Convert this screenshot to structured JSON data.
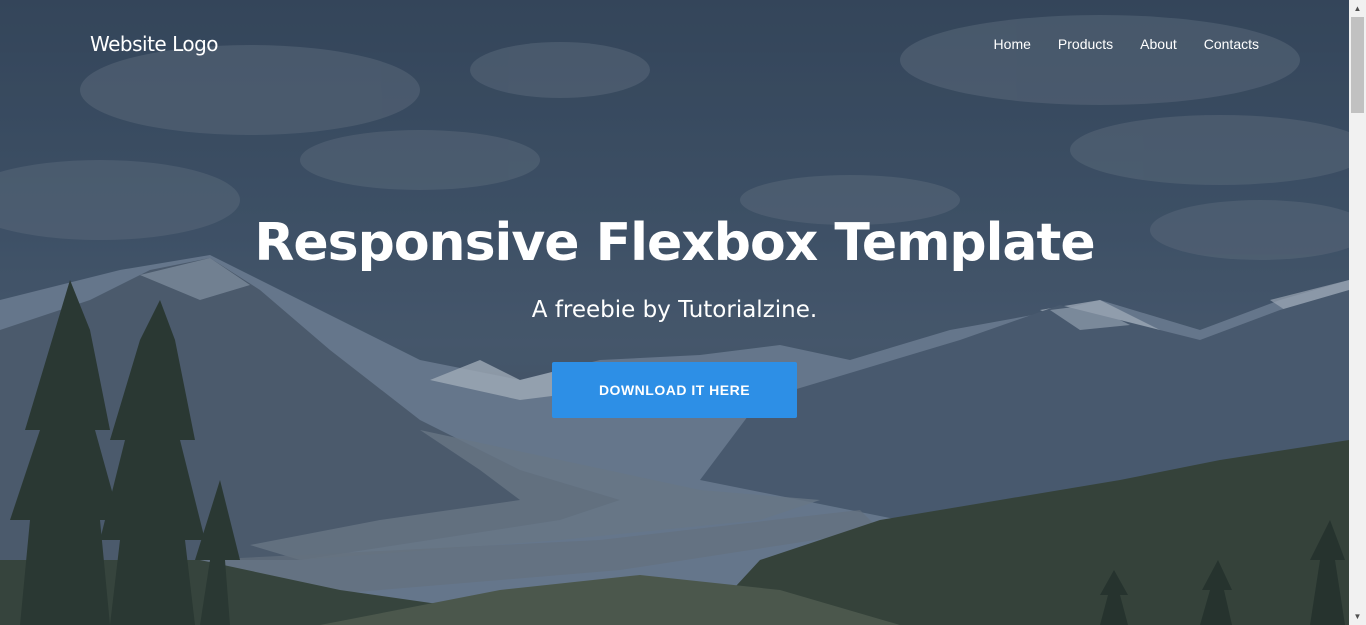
{
  "header": {
    "logo": "Website Logo",
    "nav": [
      "Home",
      "Products",
      "About",
      "Contacts"
    ]
  },
  "hero": {
    "title": "Responsive Flexbox Template",
    "subtitle": "A freebie by Tutorialzine.",
    "cta_label": "DOWNLOAD IT HERE"
  },
  "colors": {
    "cta_background": "#2d8fe6",
    "text": "#ffffff",
    "overlay": "#1e2c3e"
  },
  "icons": {
    "scroll_up": "up-arrow-icon",
    "scroll_down": "down-arrow-icon"
  },
  "scrollbar": {
    "up_glyph": "▲",
    "down_glyph": "▼"
  }
}
